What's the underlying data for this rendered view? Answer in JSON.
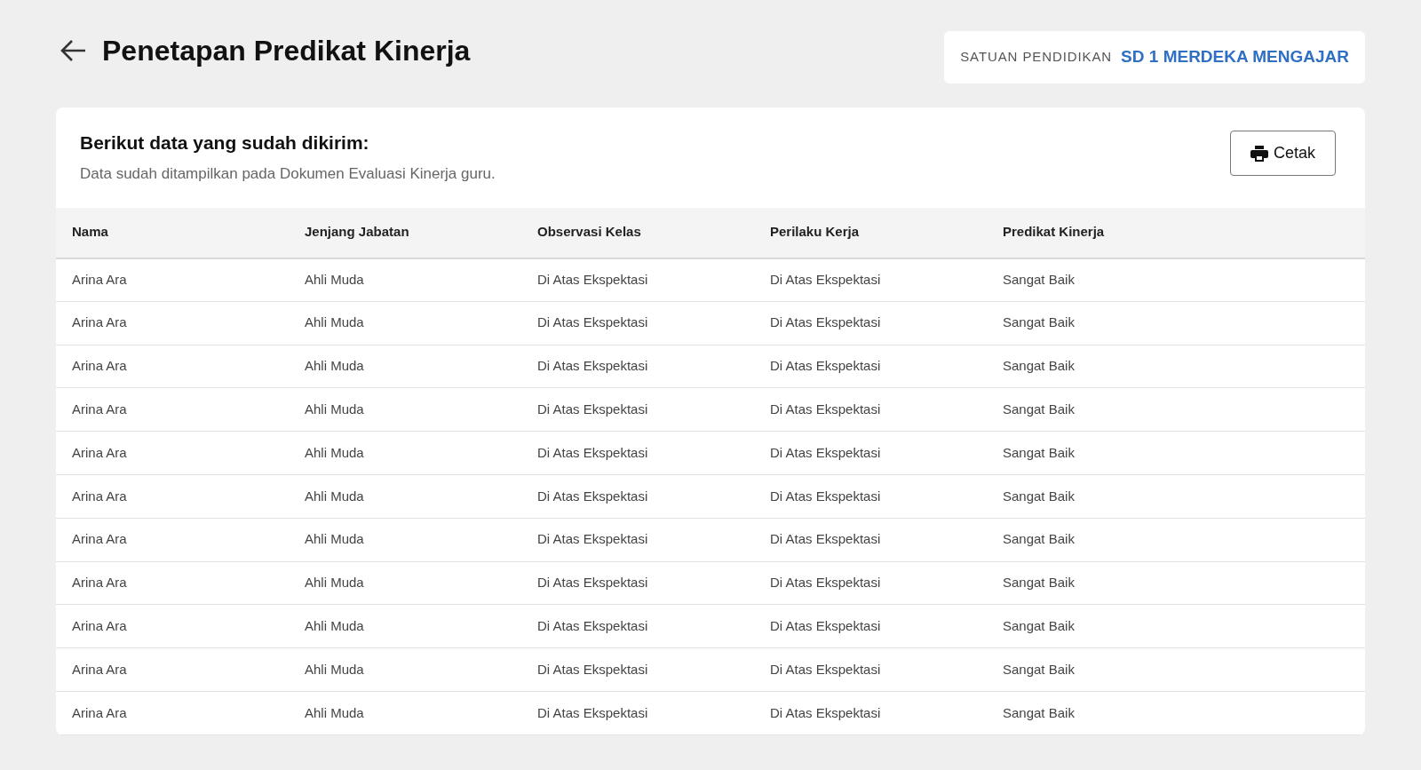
{
  "page": {
    "title": "Penetapan Predikat Kinerja"
  },
  "school": {
    "label": "SATUAN PENDIDIKAN",
    "value": "SD 1 MERDEKA MENGAJAR"
  },
  "card": {
    "heading": "Berikut data yang sudah dikirim:",
    "description": "Data sudah ditampilkan pada Dokumen Evaluasi Kinerja guru.",
    "print_button": "Cetak"
  },
  "table": {
    "columns": [
      "Nama",
      "Jenjang Jabatan",
      "Observasi Kelas",
      "Perilaku Kerja",
      "Predikat Kinerja"
    ],
    "rows": [
      [
        "Arina Ara",
        "Ahli Muda",
        "Di Atas Ekspektasi",
        "Di Atas Ekspektasi",
        "Sangat Baik"
      ],
      [
        "Arina Ara",
        "Ahli Muda",
        "Di Atas Ekspektasi",
        "Di Atas Ekspektasi",
        "Sangat Baik"
      ],
      [
        "Arina Ara",
        "Ahli Muda",
        "Di Atas Ekspektasi",
        "Di Atas Ekspektasi",
        "Sangat Baik"
      ],
      [
        "Arina Ara",
        "Ahli Muda",
        "Di Atas Ekspektasi",
        "Di Atas Ekspektasi",
        "Sangat Baik"
      ],
      [
        "Arina Ara",
        "Ahli Muda",
        "Di Atas Ekspektasi",
        "Di Atas Ekspektasi",
        "Sangat Baik"
      ],
      [
        "Arina Ara",
        "Ahli Muda",
        "Di Atas Ekspektasi",
        "Di Atas Ekspektasi",
        "Sangat Baik"
      ],
      [
        "Arina Ara",
        "Ahli Muda",
        "Di Atas Ekspektasi",
        "Di Atas Ekspektasi",
        "Sangat Baik"
      ],
      [
        "Arina Ara",
        "Ahli Muda",
        "Di Atas Ekspektasi",
        "Di Atas Ekspektasi",
        "Sangat Baik"
      ],
      [
        "Arina Ara",
        "Ahli Muda",
        "Di Atas Ekspektasi",
        "Di Atas Ekspektasi",
        "Sangat Baik"
      ],
      [
        "Arina Ara",
        "Ahli Muda",
        "Di Atas Ekspektasi",
        "Di Atas Ekspektasi",
        "Sangat Baik"
      ],
      [
        "Arina Ara",
        "Ahli Muda",
        "Di Atas Ekspektasi",
        "Di Atas Ekspektasi",
        "Sangat Baik"
      ]
    ]
  }
}
